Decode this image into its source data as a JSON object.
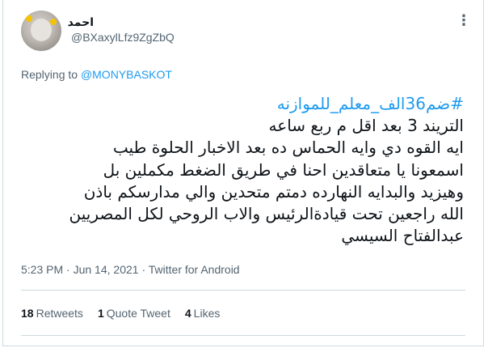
{
  "user": {
    "display_name": "احمد",
    "handle": "@BXaxylLfz9ZgZbQ"
  },
  "more_icon": "ellipsis-icon",
  "reply": {
    "prefix": "Replying to",
    "mention": "@MONYBASKOT"
  },
  "tweet": {
    "hashtag": "#ضم36الف_معلم_للموازنه",
    "lines": [
      "التريند 3 بعد اقل م ربع ساعه",
      "ايه القوه دي وايه الحماس ده بعد الاخبار الحلوة طيب",
      "اسمعونا يا متعاقدين احنا في طريق الضغط مكملين بل",
      "وهيزيد والبدايه النهارده دمتم متحدين والي مدارسكم باذن",
      "الله راجعين تحت قيادةالرئيس والاب الروحي لكل المصريين",
      "عبدالفتاح السيسي"
    ]
  },
  "meta": {
    "time": "5:23 PM",
    "separator": "·",
    "date": "Jun 14, 2021",
    "source": "Twitter for Android"
  },
  "stats": {
    "retweets_count": "18",
    "retweets_label": "Retweets",
    "quotes_count": "1",
    "quotes_label": "Quote Tweet",
    "likes_count": "4",
    "likes_label": "Likes"
  },
  "colors": {
    "link": "#1d9bf0",
    "muted": "#536471",
    "border": "#cfd9de"
  }
}
